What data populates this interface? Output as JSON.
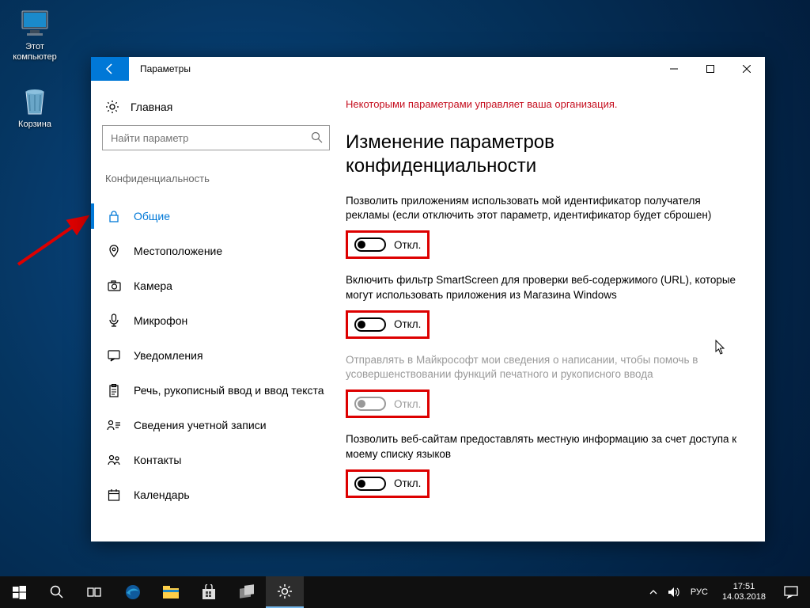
{
  "desktop": {
    "pc_label": "Этот компьютер",
    "bin_label": "Корзина"
  },
  "window": {
    "title": "Параметры",
    "home_label": "Главная",
    "search_placeholder": "Найти параметр",
    "section": "Конфиденциальность",
    "nav": [
      {
        "label": "Общие"
      },
      {
        "label": "Местоположение"
      },
      {
        "label": "Камера"
      },
      {
        "label": "Микрофон"
      },
      {
        "label": "Уведомления"
      },
      {
        "label": "Речь, рукописный ввод и ввод текста"
      },
      {
        "label": "Сведения учетной записи"
      },
      {
        "label": "Контакты"
      },
      {
        "label": "Календарь"
      }
    ]
  },
  "main": {
    "org_notice": "Некоторыми параметрами управляет ваша организация.",
    "heading": "Изменение параметров конфиденциальности",
    "settings": [
      {
        "desc": "Позволить приложениям использовать мой идентификатор получателя рекламы (если отключить этот параметр, идентификатор будет сброшен)",
        "state": "Откл.",
        "disabled": false
      },
      {
        "desc": "Включить фильтр SmartScreen для проверки веб-содержимого (URL), которые могут использовать приложения из Магазина Windows",
        "state": "Откл.",
        "disabled": false
      },
      {
        "desc": "Отправлять в Майкрософт мои сведения о написании, чтобы помочь в усовершенствовании функций печатного и рукописного ввода",
        "state": "Откл.",
        "disabled": true
      },
      {
        "desc": "Позволить веб-сайтам предоставлять местную информацию за счет доступа к моему списку языков",
        "state": "Откл.",
        "disabled": false
      }
    ]
  },
  "taskbar": {
    "lang": "РУС",
    "time": "17:51",
    "date": "14.03.2018"
  }
}
